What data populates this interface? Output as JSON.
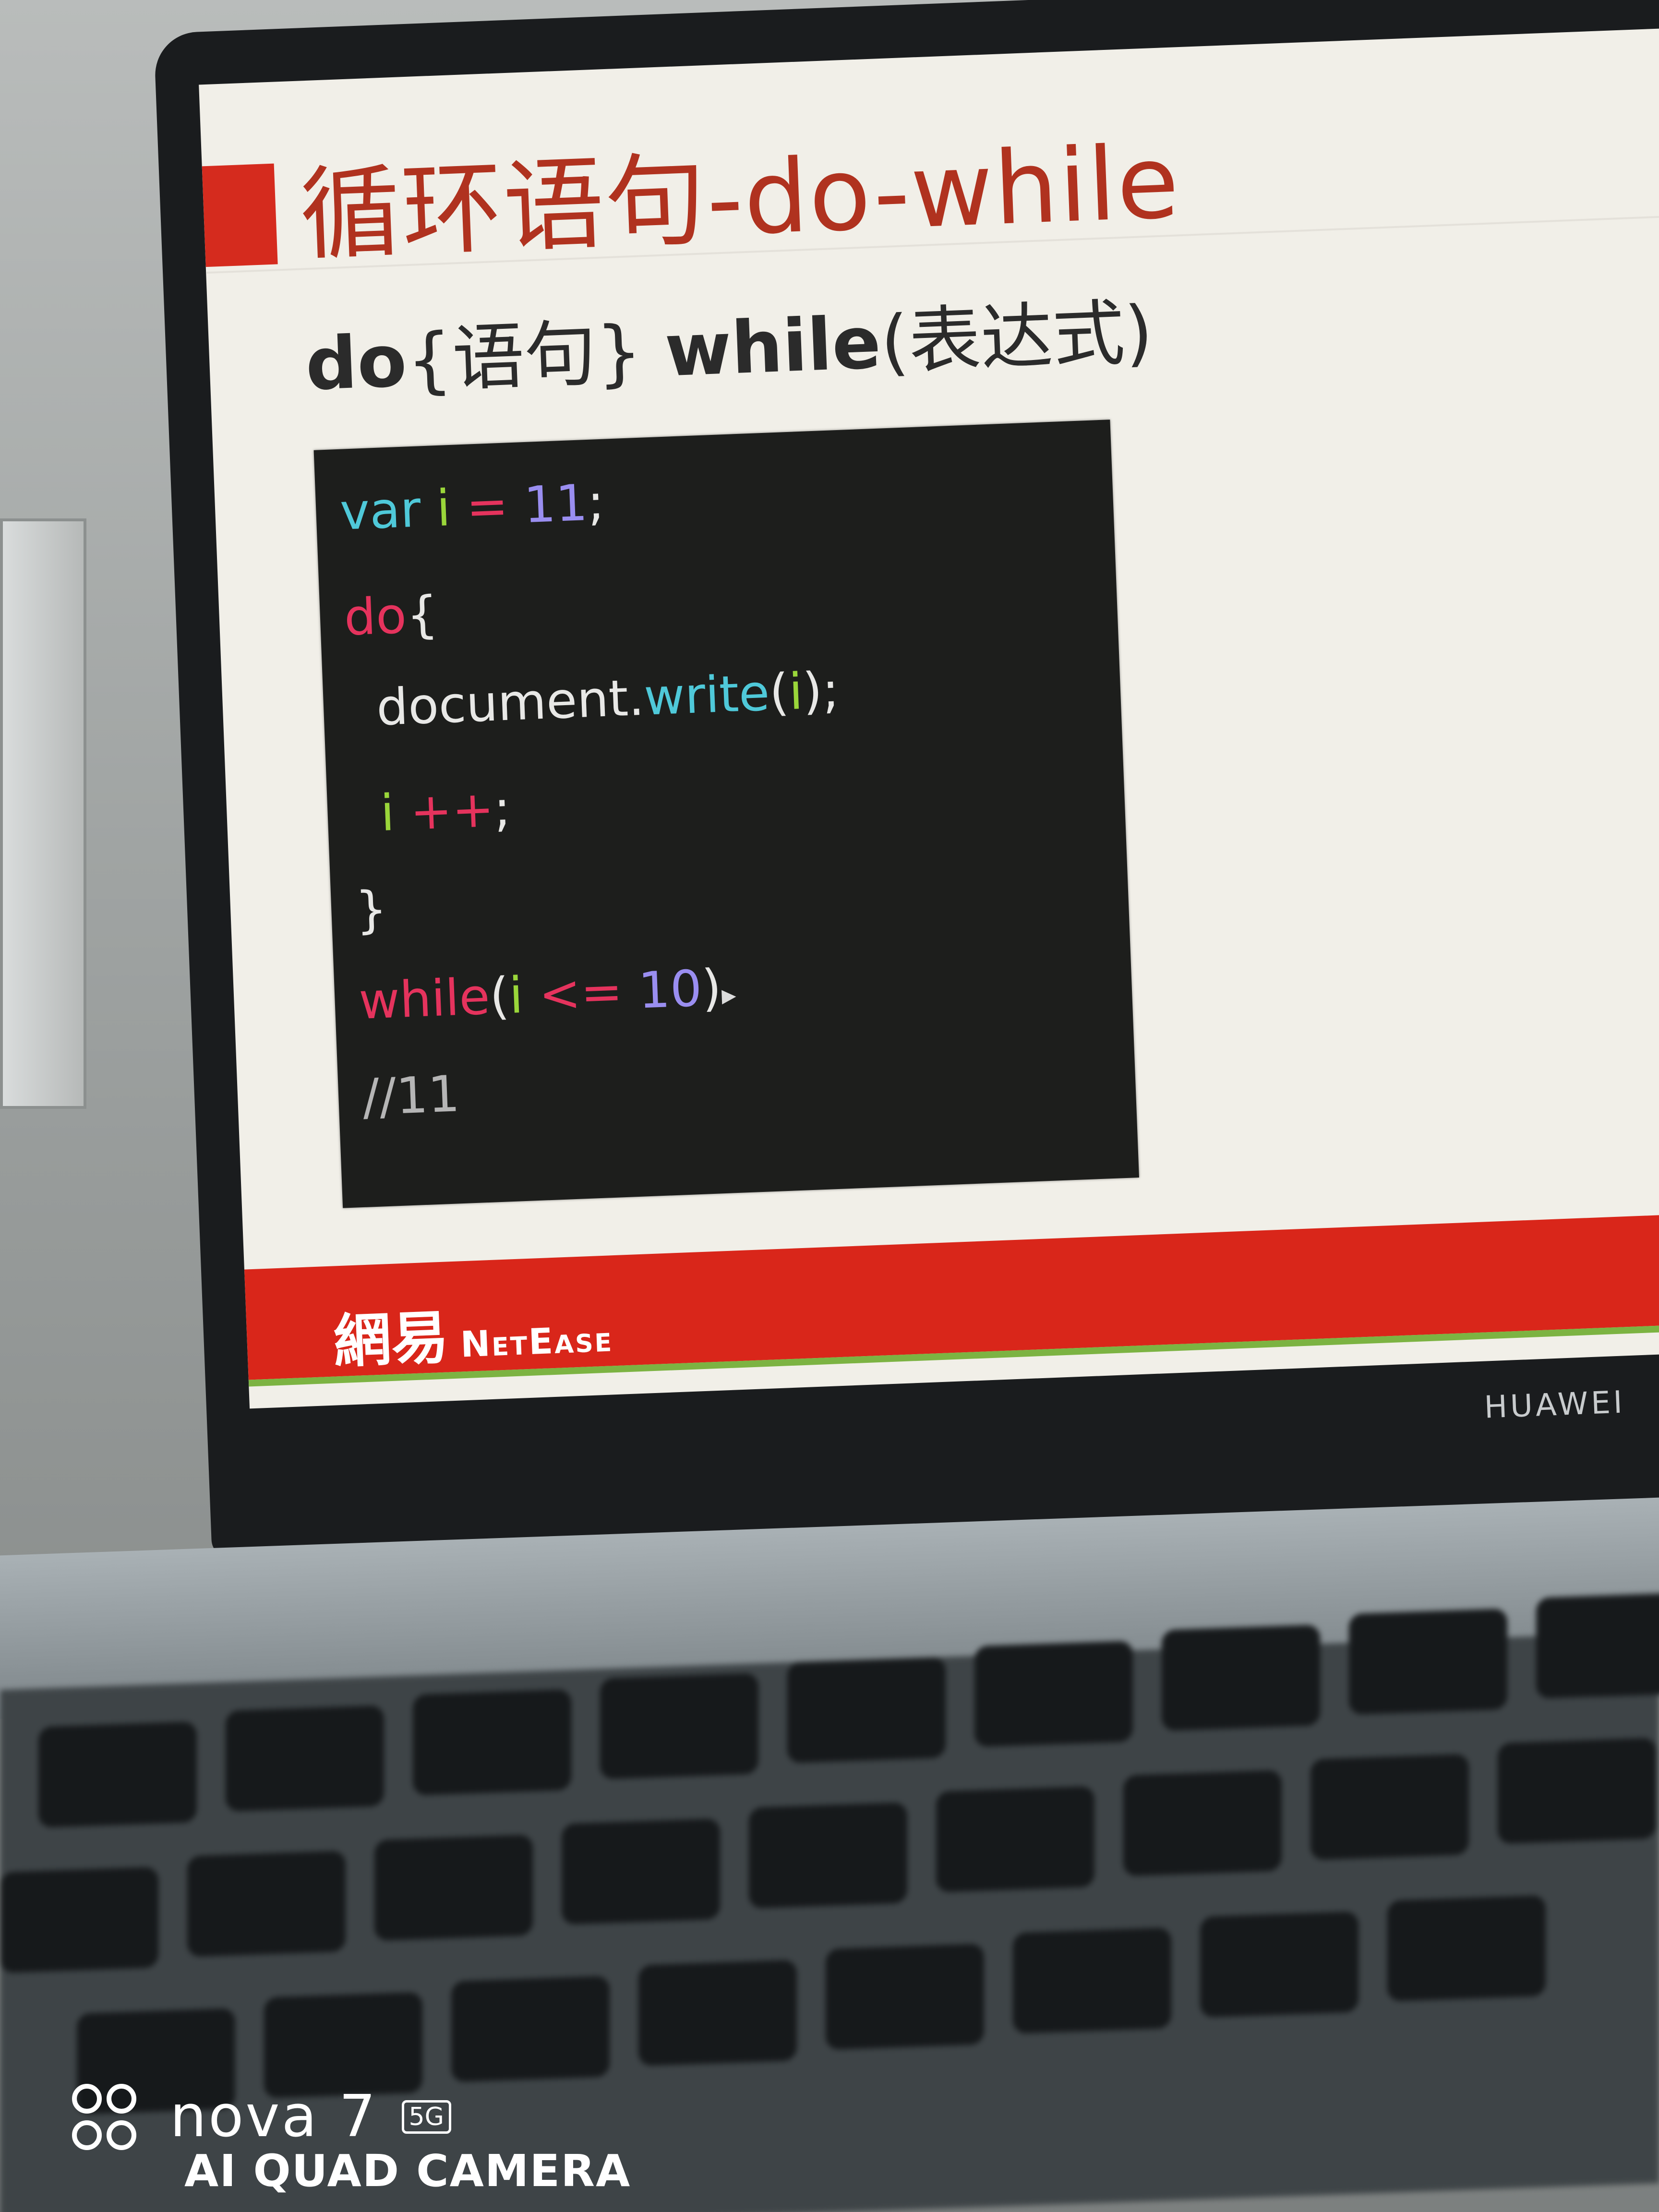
{
  "slide": {
    "title": "循环语句-do-while",
    "subtitle_do": "do",
    "subtitle_body": "{语句}",
    "subtitle_while": "while",
    "subtitle_expr": "(表达式)",
    "code": {
      "line1": {
        "kw": "var",
        "id": "i",
        "op": " = ",
        "num": "11",
        "end": ";"
      },
      "line2": {
        "kw": "do",
        "end": "{"
      },
      "line3": {
        "obj": "document.",
        "fn": "write",
        "open": "(",
        "id": "i",
        "close": ");"
      },
      "line4": {
        "id": "i",
        "op": " ++",
        "end": ";"
      },
      "line5": {
        "end": "}"
      },
      "line6": {
        "kw": "while",
        "open": "(",
        "id": "i",
        "op": " <= ",
        "num": "10",
        "close": ")"
      },
      "line7": {
        "comment": "//11"
      }
    },
    "footer": {
      "logo_cn": "網易",
      "logo_en": "NetEase"
    }
  },
  "laptop": {
    "brand": "HUAWEI"
  },
  "camera_watermark": {
    "model": "nova 7",
    "badge": "5G",
    "subtitle": "AI QUAD CAMERA"
  },
  "colors": {
    "slide_red": "#d52b1e",
    "title_red": "#b0321f",
    "code_bg": "#1d1e1c",
    "keyword_cyan": "#4fc9d9",
    "keyword_red": "#e5335d",
    "identifier_green": "#9ad63a",
    "number_purple": "#9a8ef0"
  }
}
